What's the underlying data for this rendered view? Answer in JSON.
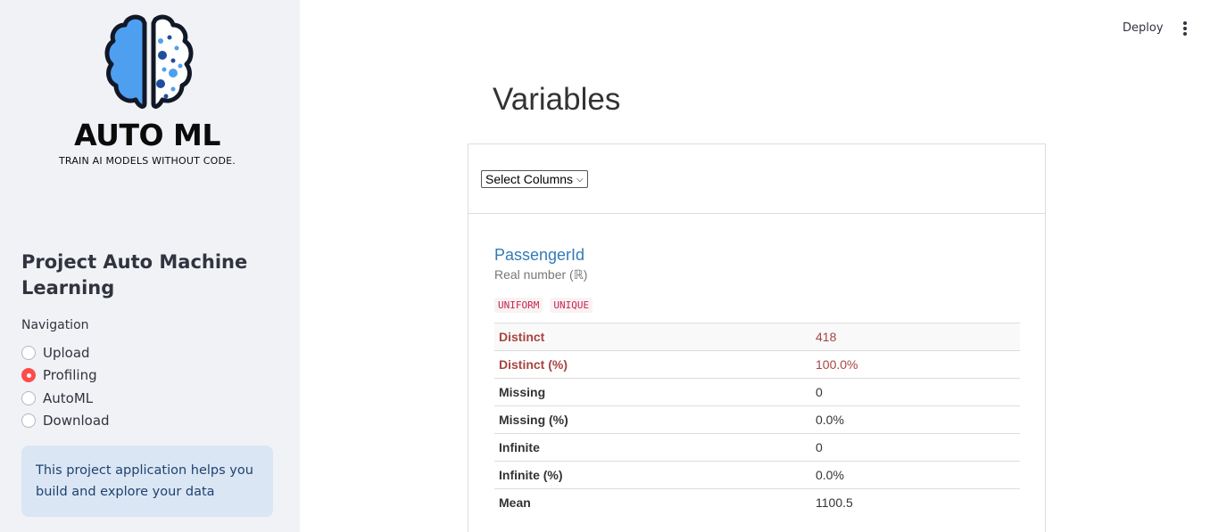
{
  "sidebar": {
    "logo": {
      "title": "AUTO ML",
      "tagline": "TRAIN AI MODELS WITHOUT CODE."
    },
    "project_title": "Project Auto Machine Learning",
    "nav_label": "Navigation",
    "nav_items": [
      {
        "label": "Upload",
        "selected": false
      },
      {
        "label": "Profiling",
        "selected": true
      },
      {
        "label": "AutoML",
        "selected": false
      },
      {
        "label": "Download",
        "selected": false
      }
    ],
    "info": "This project application helps you build and explore your data"
  },
  "header": {
    "deploy_label": "Deploy",
    "menu_icon": "kebab-menu-icon"
  },
  "main": {
    "title": "Variables",
    "select_label": "Select Columns",
    "variable": {
      "name": "PassengerId",
      "type": "Real number (ℝ)",
      "badges": [
        "UNIFORM",
        "UNIQUE"
      ],
      "stats": [
        {
          "key": "Distinct",
          "value": "418"
        },
        {
          "key": "Distinct (%)",
          "value": "100.0%"
        },
        {
          "key": "Missing",
          "value": "0"
        },
        {
          "key": "Missing (%)",
          "value": "0.0%"
        },
        {
          "key": "Infinite",
          "value": "0"
        },
        {
          "key": "Infinite (%)",
          "value": "0.0%"
        },
        {
          "key": "Mean",
          "value": "1100.5"
        }
      ]
    }
  },
  "colors": {
    "accent": "#ff4b4b",
    "link": "#337ab7",
    "alert_text": "#a94442",
    "badge_text": "#c7254e",
    "info_bg": "#dbe6f4",
    "sidebar_bg": "#f0f2f6"
  }
}
